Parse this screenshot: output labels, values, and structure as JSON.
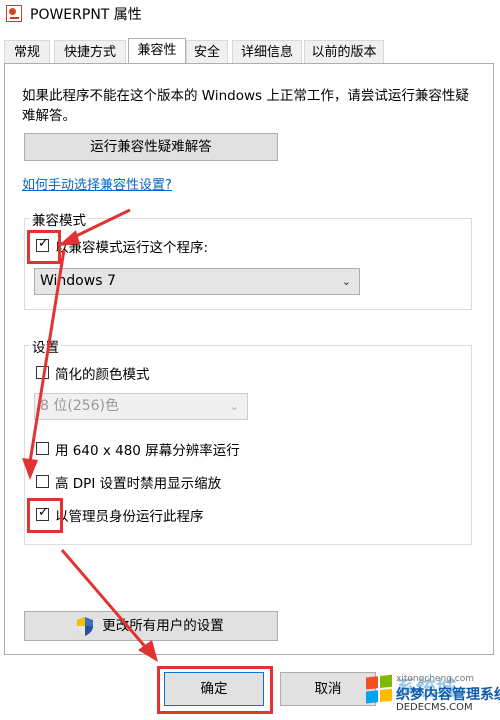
{
  "window": {
    "title": "POWERPNT 属性"
  },
  "tabs": [
    {
      "label": "常规"
    },
    {
      "label": "快捷方式"
    },
    {
      "label": "兼容性"
    },
    {
      "label": "安全"
    },
    {
      "label": "详细信息"
    },
    {
      "label": "以前的版本"
    }
  ],
  "intro": {
    "text": "如果此程序不能在这个版本的 Windows 上正常工作，请尝试运行兼容性疑难解答。",
    "troubleshoot_button": "运行兼容性疑难解答",
    "manual_link": "如何手动选择兼容性设置?"
  },
  "compat_mode": {
    "group_label": "兼容模式",
    "checkbox_label": "以兼容模式运行这个程序:",
    "checked": true,
    "selected_os": "Windows 7"
  },
  "settings": {
    "group_label": "设置",
    "reduced_color": {
      "label": "简化的颜色模式",
      "checked": false
    },
    "color_select": "8 位(256)色",
    "res_640": {
      "label": "用 640 x 480 屏幕分辨率运行",
      "checked": false
    },
    "high_dpi": {
      "label": "高 DPI 设置时禁用显示缩放",
      "checked": false
    },
    "run_as_admin": {
      "label": "以管理员身份运行此程序",
      "checked": true
    }
  },
  "change_all_button": "更改所有用户的设置",
  "footer": {
    "ok": "确定",
    "cancel": "取消"
  },
  "watermark": {
    "text_top": "系统城",
    "text_mid": "织梦内容管理系统",
    "text_bottom": "DEDECMS.COM",
    "text_faint": "xitongcheng.com"
  },
  "icons": {
    "app": "powerpoint-icon",
    "shield": "uac-shield-icon",
    "check": "✓",
    "chevron": "⌄"
  },
  "colors": {
    "annotation": "#e23232",
    "link": "#0066cc"
  }
}
